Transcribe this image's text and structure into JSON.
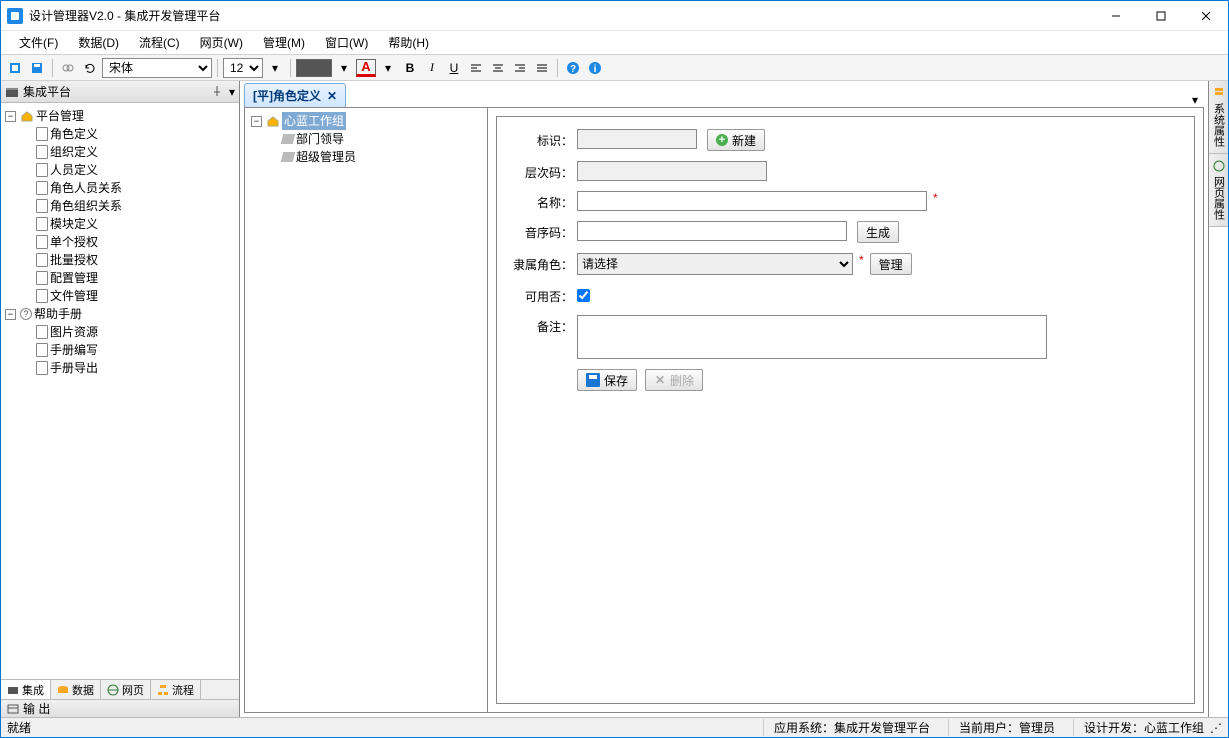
{
  "window": {
    "title": "设计管理器V2.0 - 集成开发管理平台"
  },
  "menu": [
    "文件(F)",
    "数据(D)",
    "流程(C)",
    "网页(W)",
    "管理(M)",
    "窗口(W)",
    "帮助(H)"
  ],
  "toolbar": {
    "font_name": "宋体",
    "font_size": "12"
  },
  "sidebar": {
    "title": "集成平台",
    "tree": {
      "platform": {
        "label": "平台管理",
        "children": [
          "角色定义",
          "组织定义",
          "人员定义",
          "角色人员关系",
          "角色组织关系",
          "模块定义",
          "单个授权",
          "批量授权",
          "配置管理",
          "文件管理"
        ]
      },
      "help": {
        "label": "帮助手册",
        "children": [
          "图片资源",
          "手册编写",
          "手册导出"
        ]
      }
    },
    "tabs": [
      "集成",
      "数据",
      "网页",
      "流程"
    ],
    "output": "输 出"
  },
  "doc_tab": {
    "label": "[平]角色定义"
  },
  "inner_tree": {
    "root": "心蓝工作组",
    "children": [
      "部门领导",
      "超级管理员"
    ]
  },
  "form": {
    "label_id": "标识：",
    "label_level": "层次码：",
    "label_name": "名称：",
    "label_spell": "音序码：",
    "label_parent": "隶属角色：",
    "label_enabled": "可用否：",
    "label_remark": "备注：",
    "btn_new": "新建",
    "btn_gen": "生成",
    "btn_manage": "管理",
    "btn_save": "保存",
    "btn_delete": "删除",
    "parent_placeholder": "请选择",
    "val_id": "",
    "val_level": "",
    "val_name": "",
    "val_spell": "",
    "val_remark": ""
  },
  "right_tabs": [
    "系统属性",
    "网页属性"
  ],
  "status": {
    "ready": "就绪",
    "app": "应用系统：集成开发管理平台",
    "user": "当前用户：管理员",
    "dev": "设计开发：心蓝工作组"
  }
}
